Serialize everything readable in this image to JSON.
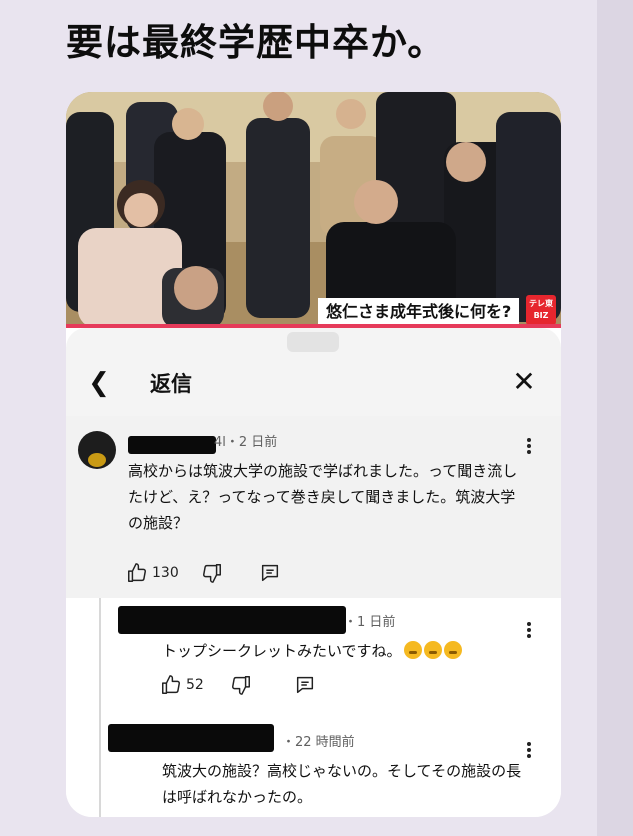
{
  "headline": "要は最終学歴中卒か。",
  "video": {
    "caption": "悠仁さま成年式後に何を?",
    "logo_top": "テレ東",
    "logo_bottom": "BIZ"
  },
  "sheet": {
    "back_icon": "chevron-left-icon",
    "title": "返信",
    "close_icon": "close-icon",
    "close_glyph": "✕",
    "back_glyph": "❮"
  },
  "comments": [
    {
      "meta": "4l・2 日前",
      "text": "高校からは筑波大学の施設で学ばれました。って聞き流したけど、え？ってなって巻き戻して聞きました。筑波大学の施設？",
      "likes": "130"
    },
    {
      "meta": "・1 日前",
      "text": "トップシークレットみたいですね。",
      "likes": "52"
    },
    {
      "meta": "・22 時間前",
      "text": "筑波大の施設？高校じゃないの。そしてその施設の長は呼ばれなかったの。"
    }
  ],
  "colors": {
    "accent_red": "#e6262e",
    "progress": "#e63a5a"
  }
}
